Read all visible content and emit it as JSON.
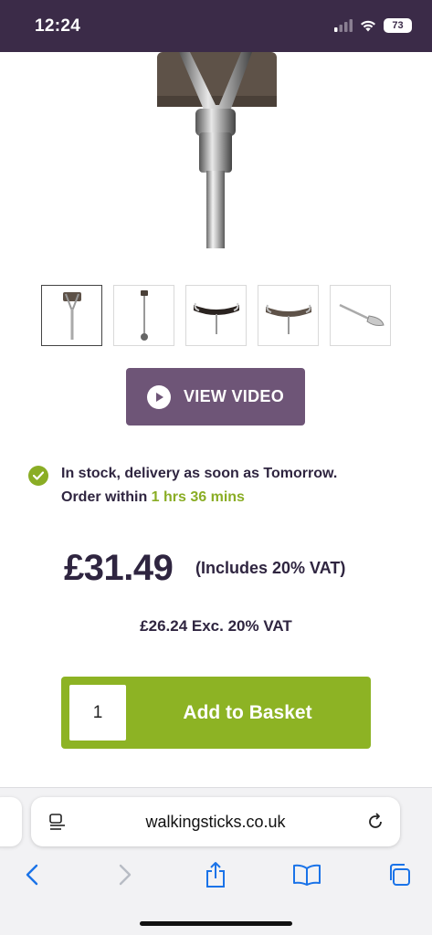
{
  "status_bar": {
    "time": "12:24",
    "battery": "73"
  },
  "product": {
    "video_button_label": "VIEW VIDEO",
    "stock_line1": "In stock, delivery as soon as Tomorrow.",
    "stock_line2_prefix": "Order within ",
    "stock_time_remaining": "1 hrs 36 mins",
    "price": "£31.49",
    "price_vat_note": "(Includes 20% VAT)",
    "price_ex_vat": "£26.24 Exc. 20% VAT",
    "quantity": "1",
    "add_to_basket_label": "Add to Basket"
  },
  "browser": {
    "url": "walkingsticks.co.uk"
  },
  "colors": {
    "brand_purple": "#3b2b48",
    "button_purple": "#6e5577",
    "accent_green": "#8db324"
  }
}
